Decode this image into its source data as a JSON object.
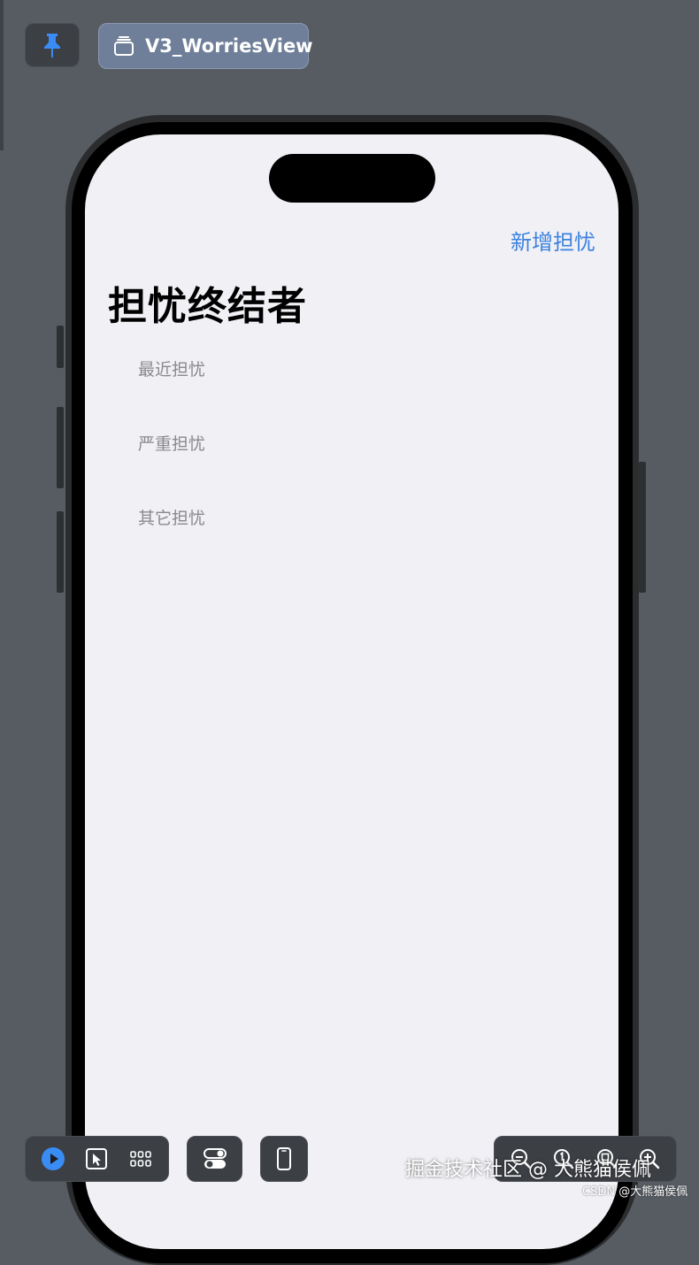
{
  "toolbar": {
    "pin_icon": "pin-icon",
    "tab_label": "V3_WorriesView",
    "tab_icon": "stack-icon"
  },
  "app": {
    "nav_action": "新增担忧",
    "title": "担忧终结者",
    "list_items": [
      {
        "label": "最近担忧"
      },
      {
        "label": "严重担忧"
      },
      {
        "label": "其它担忧"
      }
    ]
  },
  "bottom": {
    "left_group": [
      "play-icon",
      "select-pointer-icon",
      "grid-icon"
    ],
    "variants_icon": "toggles-icon",
    "device_icon": "device-icon",
    "zoom_group": [
      "zoom-out-icon",
      "zoom-100-icon",
      "zoom-fit-icon",
      "zoom-in-icon"
    ]
  },
  "watermarks": {
    "juejin": "掘金技术社区 @ 大熊猫侯佩",
    "csdn": "CSDN @大熊猫侯佩"
  },
  "colors": {
    "accent": "#3c82e0",
    "background": "#575c63",
    "screen": "#f1f0f5",
    "secondary_text": "#8a8a8e"
  }
}
